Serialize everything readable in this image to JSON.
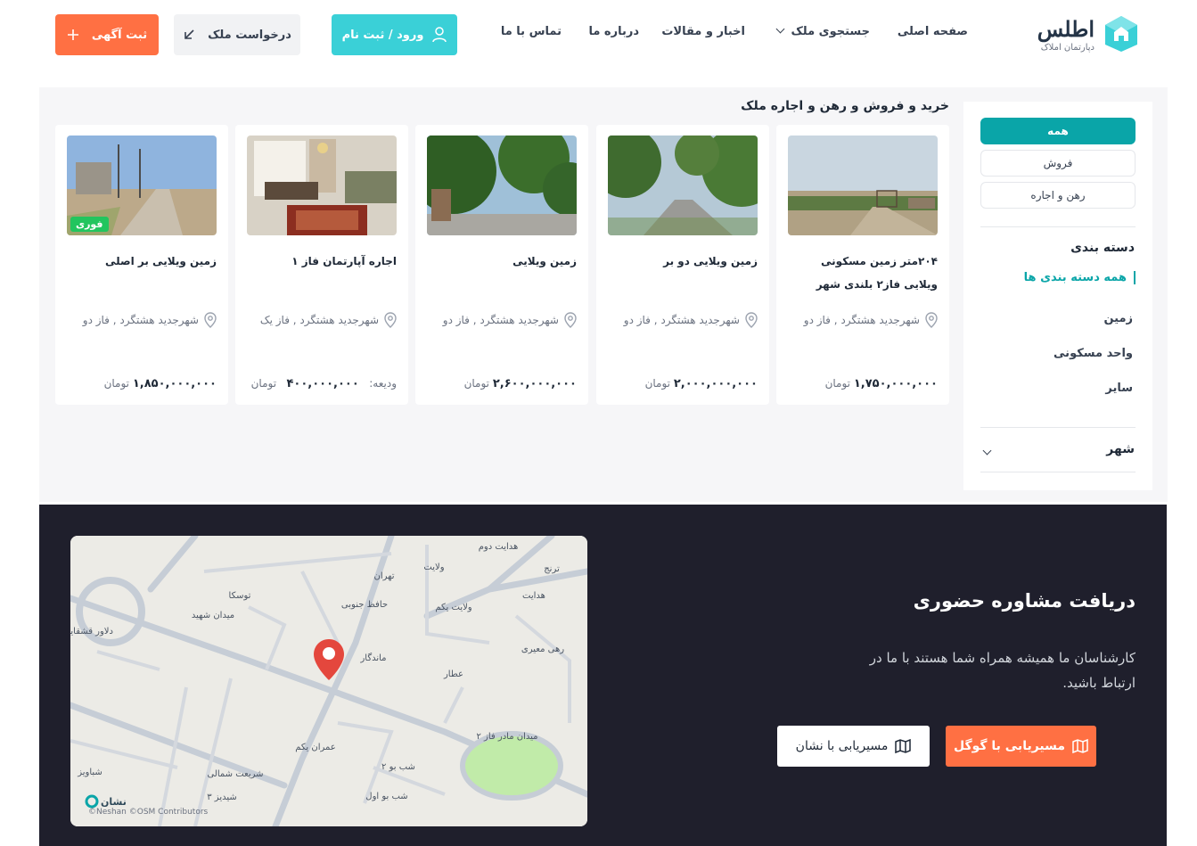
{
  "header": {
    "logo": {
      "brand": "اطلس",
      "subtitle": "دپارتمان املاک"
    },
    "nav": [
      {
        "label": "صفحه اصلی"
      },
      {
        "label": "جستجوی ملک"
      },
      {
        "label": "اخبار و مقالات"
      },
      {
        "label": "درباره ما"
      },
      {
        "label": "تماس با ما"
      }
    ],
    "login_label": "ورود / ثبت نام",
    "request_label": "درخواست ملک",
    "add_label": "ثبت آگهی"
  },
  "sidebar": {
    "filters": [
      {
        "label": "همه",
        "active": true
      },
      {
        "label": "فروش",
        "active": false
      },
      {
        "label": "رهن و اجاره",
        "active": false
      }
    ],
    "category_title": "دسته بندی",
    "categories": [
      {
        "label": "همه دسته بندی ها",
        "active": true
      },
      {
        "label": "زمین"
      },
      {
        "label": "واحد مسکونی"
      },
      {
        "label": "سایر"
      }
    ],
    "city_title": "شهر"
  },
  "listings": {
    "section_title": "خرید و فروش و رهن و اجاره ملک",
    "cards": [
      {
        "title": "۲۰۴متر زمین مسکونی ویلایی فاز۲ بلندی شهر",
        "location": "شهرجدید هشتگرد , فاز دو",
        "price_prefix": "",
        "price": "۱,۷۵۰,۰۰۰,۰۰۰",
        "currency": "تومان",
        "badge": ""
      },
      {
        "title": "زمین ویلایی دو بر",
        "location": "شهرجدید هشتگرد , فاز دو",
        "price_prefix": "",
        "price": "۲,۰۰۰,۰۰۰,۰۰۰",
        "currency": "تومان",
        "badge": ""
      },
      {
        "title": "زمین ویلایی",
        "location": "شهرجدید هشتگرد , فاز دو",
        "price_prefix": "",
        "price": "۲,۶۰۰,۰۰۰,۰۰۰",
        "currency": "تومان",
        "badge": ""
      },
      {
        "title": "اجاره آپارتمان فاز ۱",
        "location": "شهرجدید هشتگرد , فاز یک",
        "price_prefix": "ودیعه:",
        "price": "۴۰۰,۰۰۰,۰۰۰",
        "currency": "تومان",
        "badge": ""
      },
      {
        "title": "زمین ویلایی بر اصلی",
        "location": "شهرجدید هشتگرد , فاز دو",
        "price_prefix": "",
        "price": "۱,۸۵۰,۰۰۰,۰۰۰",
        "currency": "تومان",
        "badge": "فوری"
      }
    ]
  },
  "footer": {
    "title": "دریافت مشاوره حضوری",
    "text": "کارشناسان ما همیشه همراه شما هستند با ما در ارتباط باشید.",
    "google_label": "مسیریابی با گوگل",
    "neshan_label": "مسیریابی با نشان",
    "map": {
      "logo": "نشان",
      "attribution": "©Neshan ©OSM Contributors",
      "street_labels": [
        "هدایت دوم",
        "ولایت",
        "تهران",
        "توسکا",
        "حافظ جنوبی",
        "ولایت یکم",
        "هدایت",
        "میدان شهید",
        "ترنج",
        "ماندگار",
        "عطار",
        "رهی معیری",
        "میدان مادر فاز ۲",
        "عمران یکم",
        "شب بو ۲",
        "شریعت شمالی",
        "شب بو اول",
        "شیدیز ۳",
        "دلاور قشقایی",
        "شباویز"
      ]
    }
  },
  "colors": {
    "teal": "#0aa5a8",
    "cyan": "#3ad0d7",
    "orange": "#ff7043",
    "dark": "#1f1f2c"
  }
}
